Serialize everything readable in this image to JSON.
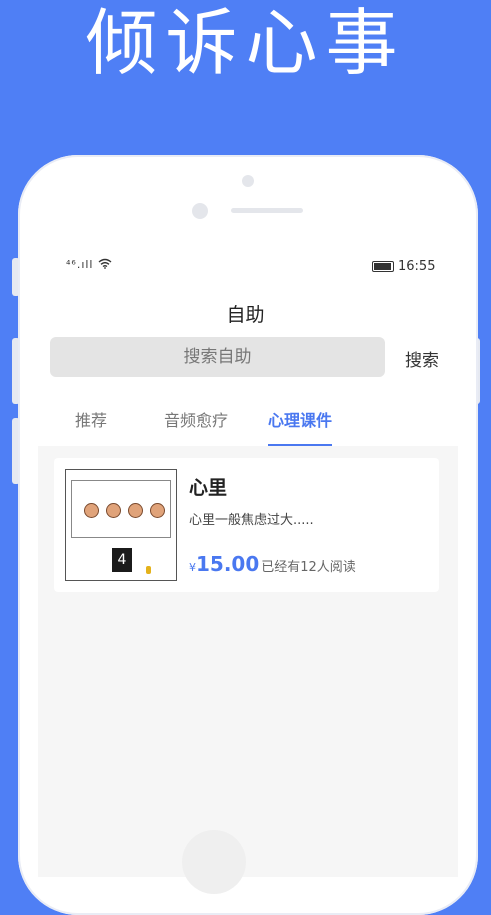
{
  "promo": {
    "headline": "倾诉心事"
  },
  "status_bar": {
    "signal_text": "⁴⁶.ıll",
    "time": "16:55"
  },
  "page": {
    "title": "自助"
  },
  "search": {
    "placeholder": "搜索自助",
    "button_label": "搜索"
  },
  "tabs": [
    {
      "label": "推荐",
      "active": false
    },
    {
      "label": "音频愈疗",
      "active": false
    },
    {
      "label": "心理课件",
      "active": true
    }
  ],
  "courses": [
    {
      "title": "心里",
      "description": "心里一般焦虑过大.....",
      "currency_symbol": "¥",
      "price": "15.00",
      "reads": "已经有12人阅读",
      "thumbnail_number": "4"
    }
  ],
  "colors": {
    "brand": "#4f7ff5",
    "accent": "#4a78f0"
  }
}
